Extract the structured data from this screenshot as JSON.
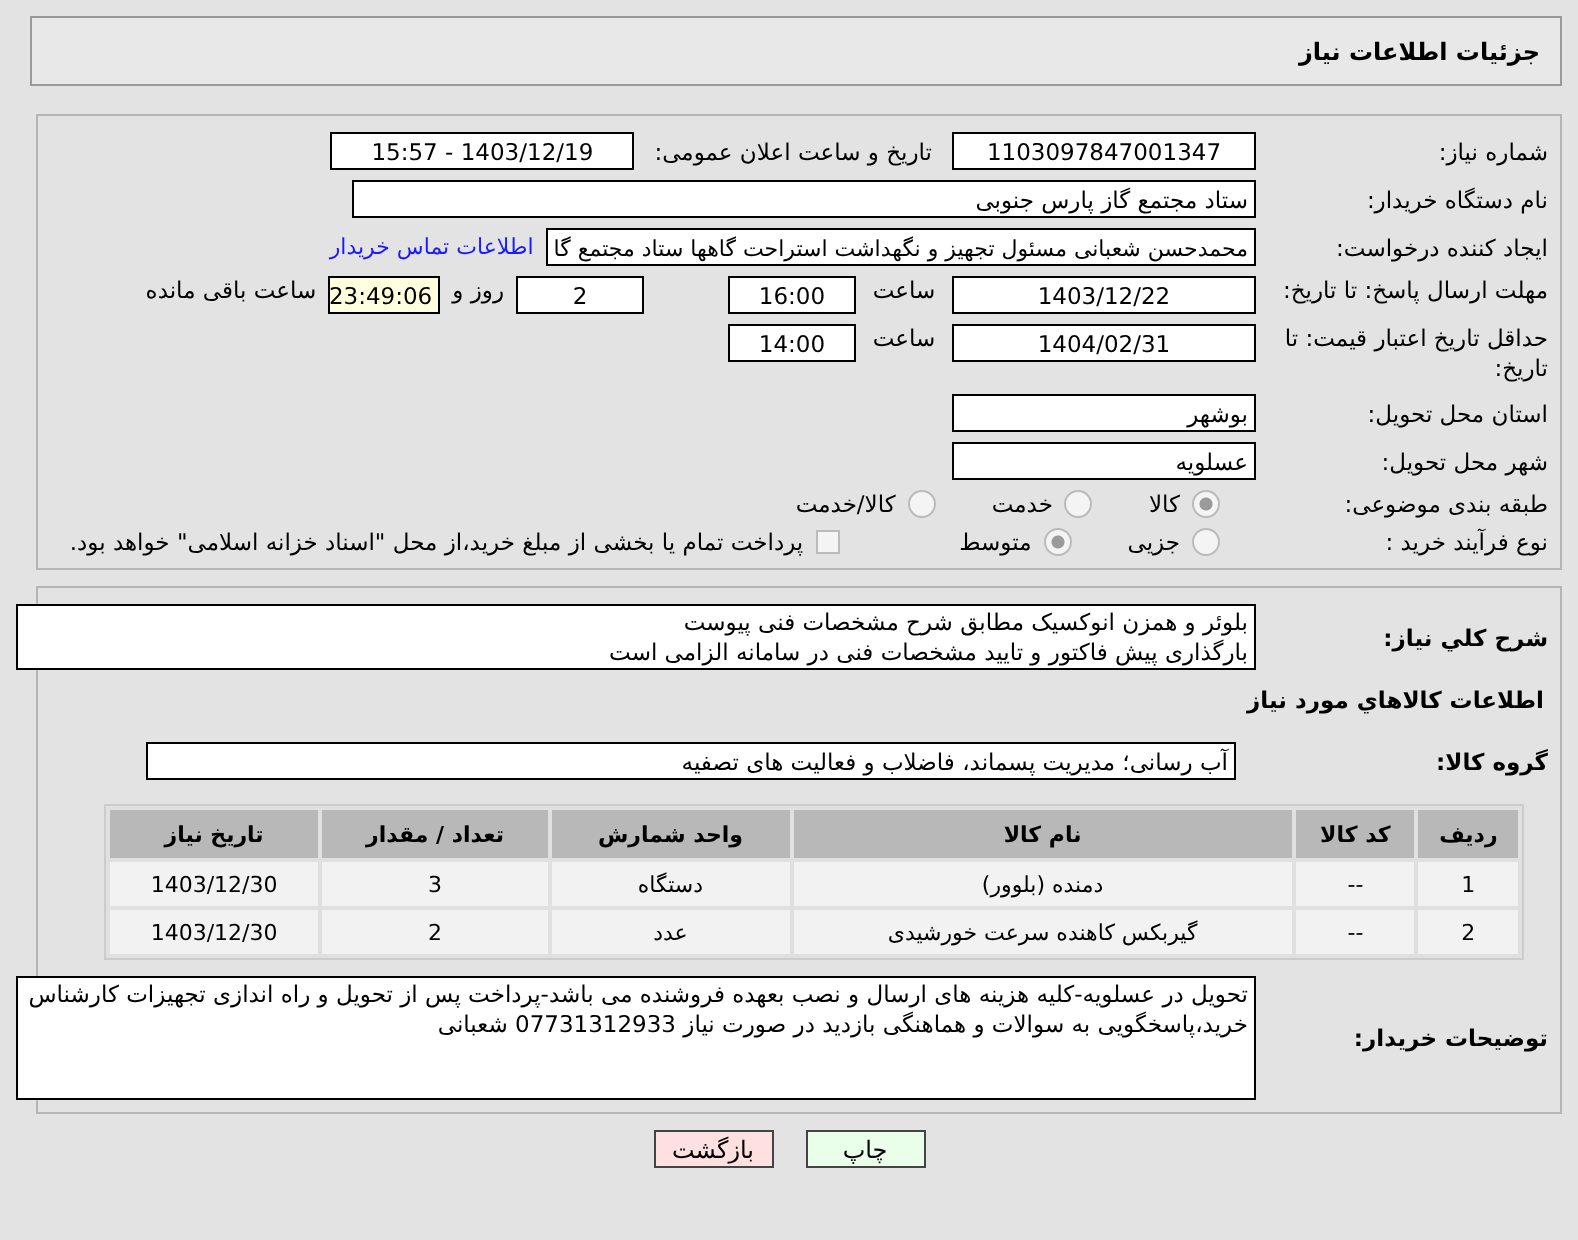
{
  "header": {
    "title": "جزئیات اطلاعات نیاز"
  },
  "form": {
    "need_number": {
      "label": "شماره نیاز:",
      "value": "1103097847001347"
    },
    "announce": {
      "label": "تاریخ و ساعت اعلان عمومی:",
      "value": "1403/12/19 - 15:57"
    },
    "buyer_org": {
      "label": "نام دستگاه خریدار:",
      "value": "ستاد مجتمع گاز پارس جنوبی"
    },
    "creator": {
      "label": "ایجاد کننده درخواست:",
      "value": "محمدحسن شعبانی مسئول تجهیز و نگهداشت استراحت گاهها ستاد مجتمع گا",
      "link": "اطلاعات تماس خریدار"
    },
    "reply_deadline": {
      "label": "مهلت ارسال پاسخ: تا تاریخ:",
      "date": "1403/12/22",
      "time_label": "ساعت",
      "time": "16:00",
      "days": "2",
      "days_label": "روز و",
      "remaining": "23:49:06",
      "remaining_label": "ساعت باقی مانده"
    },
    "price_validity": {
      "label": "حداقل تاریخ اعتبار قیمت: تا تاریخ:",
      "date": "1404/02/31",
      "time_label": "ساعت",
      "time": "14:00"
    },
    "province": {
      "label": "استان محل تحویل:",
      "value": "بوشهر"
    },
    "city": {
      "label": "شهر محل تحویل:",
      "value": "عسلویه"
    },
    "category": {
      "label": "طبقه بندی موضوعی:",
      "options": [
        {
          "label": "کالا",
          "selected": true
        },
        {
          "label": "خدمت",
          "selected": false
        },
        {
          "label": "کالا/خدمت",
          "selected": false
        }
      ]
    },
    "process": {
      "label": "نوع فرآیند خرید :",
      "options": [
        {
          "label": "جزیی",
          "selected": false
        },
        {
          "label": "متوسط",
          "selected": true
        }
      ],
      "treasury": {
        "label": "پرداخت تمام یا بخشی از مبلغ خرید،از محل \"اسناد خزانه اسلامی\" خواهد بود.",
        "checked": false
      }
    }
  },
  "description": {
    "label": "شرح کلي نياز:",
    "lines": [
      "بلوئر و همزن انوکسیک مطابق شرح مشخصات فنی پیوست",
      "بارگذاری پیش فاکتور و تایید مشخصات فنی در سامانه الزامی است"
    ]
  },
  "goods": {
    "title": "اطلاعات کالاهاي مورد نياز",
    "group_label": "گروه کالا:",
    "group_value": "آب رسانی؛ مدیریت پسماند، فاضلاب و فعالیت های تصفیه",
    "columns": [
      "ردیف",
      "کد کالا",
      "نام کالا",
      "واحد شمارش",
      "تعداد / مقدار",
      "تاریخ نیاز"
    ],
    "rows": [
      [
        "1",
        "--",
        "دمنده (بلوور)",
        "دستگاه",
        "3",
        "1403/12/30"
      ],
      [
        "2",
        "--",
        "گیربکس کاهنده سرعت خورشیدی",
        "عدد",
        "2",
        "1403/12/30"
      ]
    ]
  },
  "notes": {
    "label": "توضیحات خریدار:",
    "text": "تحویل در عسلویه-کلیه هزینه های ارسال و نصب بعهده فروشنده می باشد-پرداخت پس از تحویل و راه اندازی تجهیزات کارشناس خرید،پاسخگویی به سوالات و هماهنگی بازدید در صورت نیاز 07731312933 شعبانی"
  },
  "buttons": [
    {
      "label": "چاپ",
      "kind": "print"
    },
    {
      "label": "بازگشت",
      "kind": "back"
    }
  ]
}
